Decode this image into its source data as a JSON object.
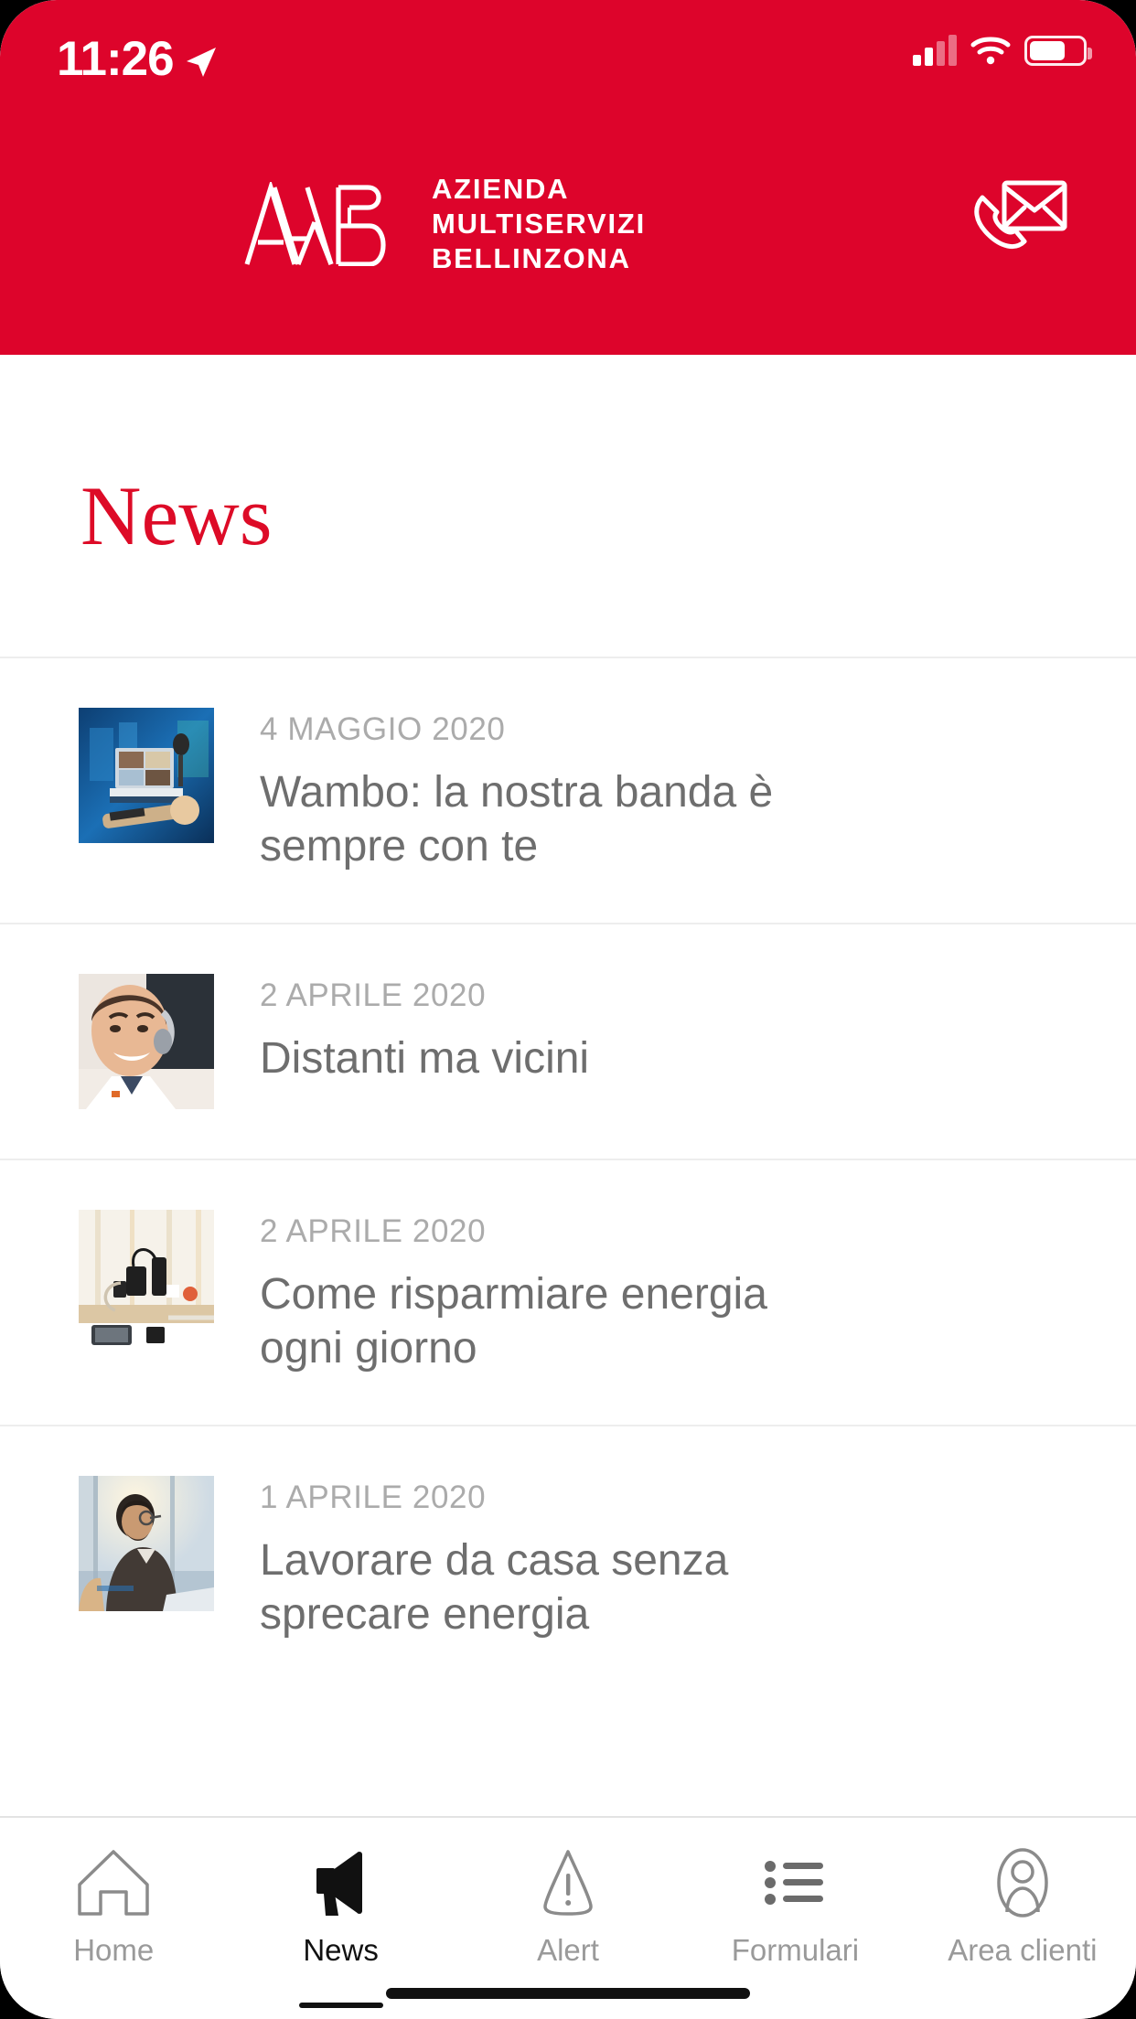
{
  "status_bar": {
    "time": "11:26",
    "location_icon": "location-arrow-icon",
    "signal_icon": "cellular-signal-icon",
    "wifi_icon": "wifi-icon",
    "battery_icon": "battery-icon",
    "battery_level": 62
  },
  "header": {
    "background_color": "#DD042B",
    "logo_mark": "amb-logo-mark",
    "brand_line1": "AZIENDA",
    "brand_line2": "MULTISERVIZI",
    "brand_line3": "BELLINZONA",
    "contact_icon": "phone-envelope-contact-icon"
  },
  "page": {
    "title": "News",
    "title_color": "#DD0B27"
  },
  "news": [
    {
      "date": "4 MAGGIO 2020",
      "title": "Wambo: la nostra banda è sempre con te",
      "thumb_name": "thumb-home-music-studio"
    },
    {
      "date": "2 APRILE 2020",
      "title": "Distanti ma vicini",
      "thumb_name": "thumb-call-center-agent"
    },
    {
      "date": "2 APRILE 2020",
      "title": "Come risparmiare energia ogni giorno",
      "thumb_name": "thumb-chargers-on-desk"
    },
    {
      "date": "1 APRILE 2020",
      "title": "Lavorare da casa senza sprecare energia",
      "thumb_name": "thumb-man-at-laptop"
    }
  ],
  "tabbar": {
    "items": [
      {
        "label": "Home",
        "icon": "home-icon",
        "active": false
      },
      {
        "label": "News",
        "icon": "megaphone-icon",
        "active": true
      },
      {
        "label": "Alert",
        "icon": "warning-triangle-icon",
        "active": false
      },
      {
        "label": "Formulari",
        "icon": "bulleted-list-icon",
        "active": false
      },
      {
        "label": "Area clienti",
        "icon": "person-icon",
        "active": false
      }
    ]
  }
}
